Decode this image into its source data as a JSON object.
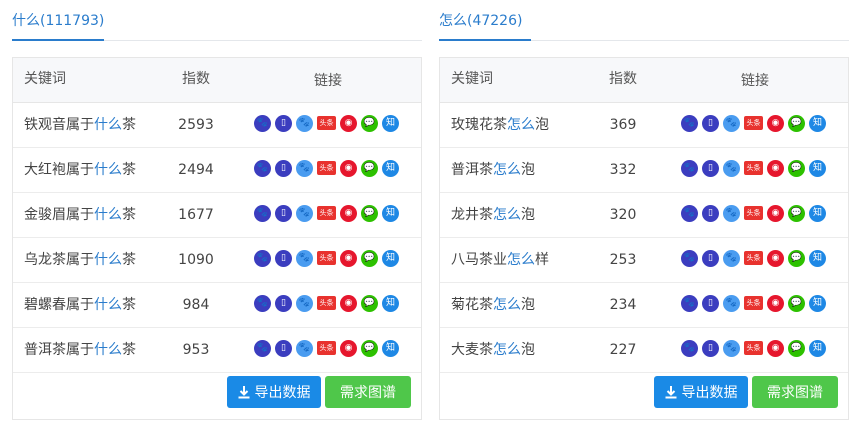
{
  "left": {
    "tab": "什么(111793)",
    "headers": {
      "keyword": "关键词",
      "index": "指数",
      "links": "链接"
    },
    "rows": [
      {
        "pre": "铁观音属于",
        "hl": "什么",
        "post": "茶",
        "index": "2593"
      },
      {
        "pre": "大红袍属于",
        "hl": "什么",
        "post": "茶",
        "index": "2494"
      },
      {
        "pre": "金骏眉属于",
        "hl": "什么",
        "post": "茶",
        "index": "1677"
      },
      {
        "pre": "乌龙茶属于",
        "hl": "什么",
        "post": "茶",
        "index": "1090"
      },
      {
        "pre": "碧螺春属于",
        "hl": "什么",
        "post": "茶",
        "index": "984"
      },
      {
        "pre": "普洱茶属于",
        "hl": "什么",
        "post": "茶",
        "index": "953"
      }
    ],
    "export_label": "导出数据",
    "request_label": "需求图谱"
  },
  "right": {
    "tab": "怎么(47226)",
    "headers": {
      "keyword": "关键词",
      "index": "指数",
      "links": "链接"
    },
    "rows": [
      {
        "pre": "玫瑰花茶",
        "hl": "怎么",
        "post": "泡",
        "index": "369"
      },
      {
        "pre": "普洱茶",
        "hl": "怎么",
        "post": "泡",
        "index": "332"
      },
      {
        "pre": "龙井茶",
        "hl": "怎么",
        "post": "泡",
        "index": "320"
      },
      {
        "pre": "八马茶业",
        "hl": "怎么",
        "post": "样",
        "index": "253"
      },
      {
        "pre": "菊花茶",
        "hl": "怎么",
        "post": "泡",
        "index": "234"
      },
      {
        "pre": "大麦茶",
        "hl": "怎么",
        "post": "泡",
        "index": "227"
      }
    ],
    "export_label": "导出数据",
    "request_label": "需求图谱"
  },
  "link_icons": [
    {
      "name": "baidu-pc-icon",
      "glyph": "🐾",
      "label": ""
    },
    {
      "name": "baidu-mobile-icon",
      "glyph": "▯",
      "label": ""
    },
    {
      "name": "baidu-index-icon",
      "glyph": "🐾",
      "label": ""
    },
    {
      "name": "toutiao-icon",
      "glyph": "",
      "label": "头条"
    },
    {
      "name": "weibo-icon",
      "glyph": "◉",
      "label": ""
    },
    {
      "name": "wechat-icon",
      "glyph": "💬",
      "label": ""
    },
    {
      "name": "zhihu-icon",
      "glyph": "",
      "label": "知"
    }
  ],
  "colors": {
    "accent": "#2a7ccc",
    "export": "#1a8ae6",
    "request": "#4fc74a"
  }
}
